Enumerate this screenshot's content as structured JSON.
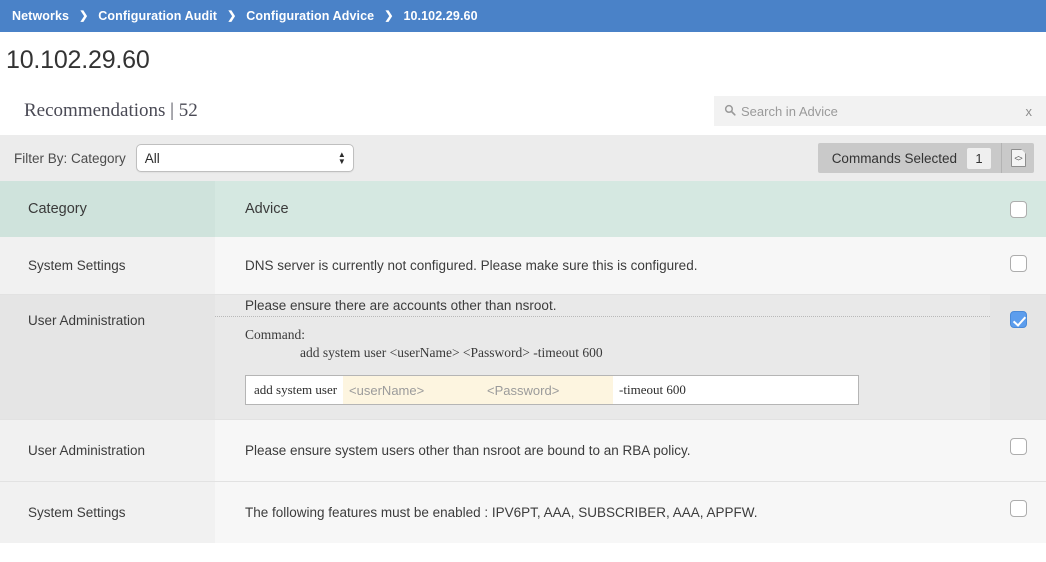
{
  "breadcrumb": {
    "separator": "❯",
    "items": [
      {
        "label": "Networks"
      },
      {
        "label": "Configuration Audit"
      },
      {
        "label": "Configuration Advice"
      },
      {
        "label": "10.102.29.60"
      }
    ]
  },
  "page": {
    "title": "10.102.29.60",
    "recommendations_label": "Recommendations | 52"
  },
  "search": {
    "placeholder": "Search in Advice",
    "value": "",
    "clear_label": "x",
    "icon": "search-icon"
  },
  "filter": {
    "label": "Filter By: Category",
    "selected": "All",
    "options": [
      "All"
    ],
    "arrow_up": "▲",
    "arrow_down": "▼"
  },
  "commands": {
    "label": "Commands Selected",
    "count": "1",
    "icon": "code-document-icon",
    "icon_glyph": "<>"
  },
  "table": {
    "columns": {
      "category": "Category",
      "advice": "Advice"
    },
    "rows": [
      {
        "category": "System Settings",
        "advice": "DNS server is currently not configured. Please make sure this is configured.",
        "checked": false,
        "expanded": false
      },
      {
        "category": "User Administration",
        "advice": "Please ensure there are accounts other than nsroot.",
        "checked": true,
        "expanded": true,
        "command": {
          "heading": "Command:",
          "template": "add system user <userName> <Password> -timeout 600",
          "tokens": {
            "prefix": "add system user",
            "placeholder_username": "<userName>",
            "placeholder_password": "<Password>",
            "suffix": "-timeout 600"
          }
        }
      },
      {
        "category": "User Administration",
        "advice": "Please ensure system users other than nsroot are bound to an RBA policy.",
        "checked": false,
        "expanded": false
      },
      {
        "category": "System Settings",
        "advice": "The following features must be enabled : IPV6PT, AAA, SUBSCRIBER, AAA, APPFW.",
        "checked": false,
        "expanded": false
      }
    ]
  },
  "colors": {
    "breadcrumb_bg": "#4a82c8",
    "table_header_bg": "#d5e8e1",
    "table_header_cat_bg": "#cfe3dc",
    "checkbox_checked": "#5c9ded",
    "placeholder_highlight": "#fdf5e0",
    "filter_bar_bg": "#ececec"
  }
}
